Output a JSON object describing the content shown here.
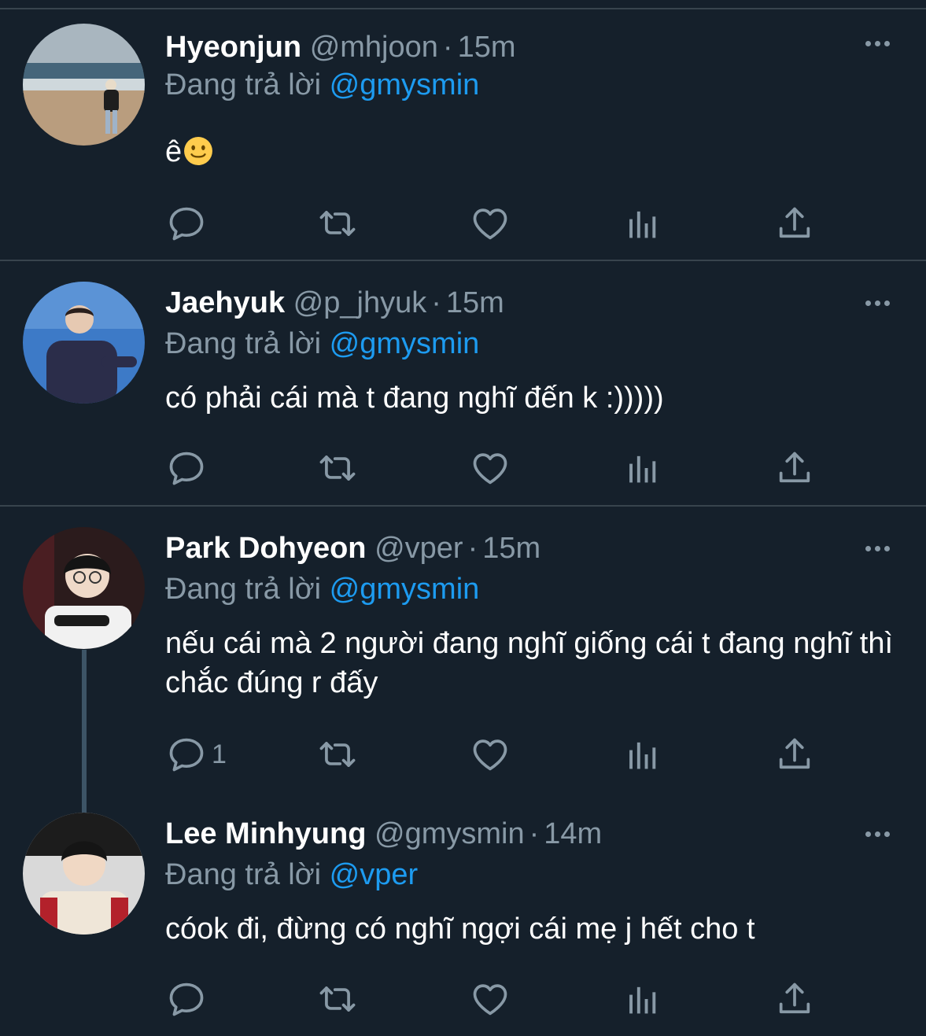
{
  "colors": {
    "background": "#15202b",
    "divider": "#38444d",
    "secondary_text": "#8899a6",
    "link": "#1d9bf0"
  },
  "tweets": [
    {
      "name": "Hyeonjun",
      "handle": "@mhjoon",
      "time": "15m",
      "reply_prefix": "Đang trả lời",
      "reply_to": "@gmysmin",
      "text": "ê",
      "emoji": "slightly-smiling-face",
      "reply_count": ""
    },
    {
      "name": "Jaehyuk",
      "handle": "@p_jhyuk",
      "time": "15m",
      "reply_prefix": "Đang trả lời",
      "reply_to": "@gmysmin",
      "text": "có phải cái mà t đang nghĩ đến k :)))))",
      "reply_count": ""
    },
    {
      "name": "Park Dohyeon",
      "handle": "@vper",
      "time": "15m",
      "reply_prefix": "Đang trả lời",
      "reply_to": "@gmysmin",
      "text": "nếu cái mà 2 người đang nghĩ giống cái t đang nghĩ thì chắc đúng r đấy",
      "reply_count": "1"
    },
    {
      "name": "Lee Minhyung",
      "handle": "@gmysmin",
      "time": "14m",
      "reply_prefix": "Đang trả lời",
      "reply_to": "@vper",
      "text": "cóok đi, đừng có nghĩ ngợi cái mẹ j hết cho t",
      "reply_count": ""
    }
  ],
  "icons": [
    "more-icon",
    "reply-icon",
    "retweet-icon",
    "like-icon",
    "analytics-icon",
    "share-icon"
  ]
}
